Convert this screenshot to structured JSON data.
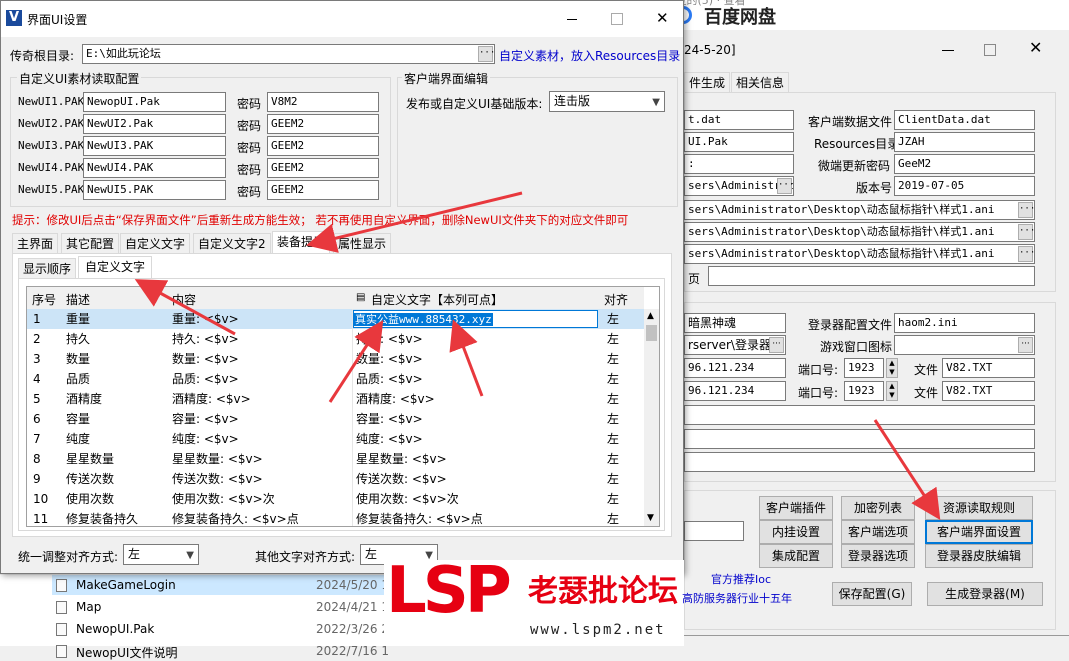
{
  "baidu": {
    "title": "百度网盘",
    "partial_top": "·拉的(5) · 查看"
  },
  "back_window": {
    "date_partial": "24-5-20]",
    "tabs": [
      "件生成",
      "相关信息"
    ],
    "fields": {
      "f1": "t.dat",
      "client_data_label": "客户端数据文件",
      "client_data_value": "ClientData.dat",
      "f2": "UI.Pak",
      "resources_label": "Resources目录",
      "resources_value": "JZAH",
      "f3": ":",
      "micro_pwd_label": "微端更新密码",
      "micro_pwd_value": "GeeM2",
      "f4": "sers\\Administrat",
      "version_label": "版本号",
      "version_value": "2019-07-05",
      "path1": "sers\\Administrator\\Desktop\\动态鼠标指针\\样式1.ani",
      "path2": "sers\\Administrator\\Desktop\\动态鼠标指针\\样式1.ani",
      "path3": "sers\\Administrator\\Desktop\\动态鼠标指针\\样式1.ani",
      "page_label": "页",
      "name_value": "暗黑神魂",
      "login_cfg_label": "登录器配置文件",
      "login_cfg_value": "haom2.ini",
      "f5": "rserver\\登录器",
      "game_icon_label": "游戏窗口图标",
      "ip1": "96.121.234",
      "port_label1": "端口号:",
      "port1": "1923",
      "file_label1": "文件",
      "file1": "V82.TXT",
      "ip2": "96.121.234",
      "port_label2": "端口号:",
      "port2": "1923",
      "file_label2": "文件",
      "file2": "V82.TXT"
    },
    "buttons": {
      "client_plugin": "客户端插件",
      "encrypt_list": "加密列表",
      "res_rule": "资源读取规则",
      "hang_setting": "内挂设置",
      "client_option": "客户端选项",
      "client_ui": "客户端界面设置",
      "integrate": "集成配置",
      "login_option": "登录器选项",
      "login_skin": "登录器皮肤编辑",
      "save_cfg": "保存配置(G)",
      "gen_login": "生成登录器(M)"
    },
    "official": "官方推荐Ioc",
    "slogan": "高防服务器行业十五年"
  },
  "files": [
    {
      "name": "MakeGameLogin",
      "date": "2024/5/20 1"
    },
    {
      "name": "Map",
      "date": "2024/4/21 1"
    },
    {
      "name": "NewopUI.Pak",
      "date": "2022/3/26 2"
    },
    {
      "name": "NewopUI文件说明",
      "date": "2022/7/16 1"
    }
  ],
  "dialog": {
    "title": "界面UI设置",
    "root_label": "传奇根目录:",
    "root_value": "E:\\如此玩论坛",
    "custom_link": "自定义素材，放入Resources目录",
    "group_custom": "自定义UI素材读取配置",
    "group_client": "客户端界面编辑",
    "pwd_label": "密码",
    "paks": [
      {
        "label": "NewUI1.PAK",
        "file": "NewopUI.Pak",
        "pwd": "V8M2"
      },
      {
        "label": "NewUI2.PAK",
        "file": "NewUI2.Pak",
        "pwd": "GEEM2"
      },
      {
        "label": "NewUI3.PAK",
        "file": "NewUI3.PAK",
        "pwd": "GEEM2"
      },
      {
        "label": "NewUI4.PAK",
        "file": "NewUI4.PAK",
        "pwd": "GEEM2"
      },
      {
        "label": "NewUI5.PAK",
        "file": "NewUI5.PAK",
        "pwd": "GEEM2"
      }
    ],
    "version_label": "发布或自定义UI基础版本:",
    "version_value": "连击版",
    "tip": "提示：修改UI后点击“保存界面文件”后重新生成方能生效；   若不再使用自定义界面，删除NewUI文件夹下的对应文件即可",
    "tabs": [
      "主界面",
      "其它配置",
      "自定义文字",
      "自定义文字2",
      "装备提示",
      "属性显示"
    ],
    "subtabs": [
      "显示顺序",
      "自定义文字"
    ],
    "columns": [
      "序号",
      "描述",
      "内容",
      "自定义文字【本列可点】",
      "对齐"
    ],
    "rows": [
      {
        "no": "1",
        "desc": "重量",
        "content": "重量: <$v>",
        "custom": "真实公益www.885432.xyz",
        "align": "左"
      },
      {
        "no": "2",
        "desc": "持久",
        "content": "持久: <$v>",
        "custom": "持久: <$v>",
        "align": "左"
      },
      {
        "no": "3",
        "desc": "数量",
        "content": "数量: <$v>",
        "custom": "数量: <$v>",
        "align": "左"
      },
      {
        "no": "4",
        "desc": "品质",
        "content": "品质: <$v>",
        "custom": "品质: <$v>",
        "align": "左"
      },
      {
        "no": "5",
        "desc": "酒精度",
        "content": "酒精度: <$v>",
        "custom": "酒精度: <$v>",
        "align": "左"
      },
      {
        "no": "6",
        "desc": "容量",
        "content": "容量: <$v>",
        "custom": "容量: <$v>",
        "align": "左"
      },
      {
        "no": "7",
        "desc": "纯度",
        "content": "纯度: <$v>",
        "custom": "纯度: <$v>",
        "align": "左"
      },
      {
        "no": "8",
        "desc": "星星数量",
        "content": "星星数量: <$v>",
        "custom": "星星数量: <$v>",
        "align": "左"
      },
      {
        "no": "9",
        "desc": "传送次数",
        "content": "传送次数: <$v>",
        "custom": "传送次数: <$v>",
        "align": "左"
      },
      {
        "no": "10",
        "desc": "使用次数",
        "content": "使用次数: <$v>次",
        "custom": "使用次数: <$v>次",
        "align": "左"
      },
      {
        "no": "11",
        "desc": "修复装备持久",
        "content": "修复装备持久: <$v>点",
        "custom": "修复装备持久: <$v>点",
        "align": "左"
      }
    ],
    "align_all_label": "统一调整对齐方式:",
    "align_all_value": "左",
    "other_align_label": "其他文字对齐方式:",
    "other_align_value": "左"
  },
  "watermark": {
    "logo": "LSP",
    "name": "老瑟批论坛",
    "url": "www.lspm2.net"
  },
  "colors": {
    "tip_red": "#e00000",
    "link_blue": "#0000cc",
    "arrow_red": "#e8383d",
    "selection": "#0078d7",
    "logo_red": "#e60012"
  }
}
